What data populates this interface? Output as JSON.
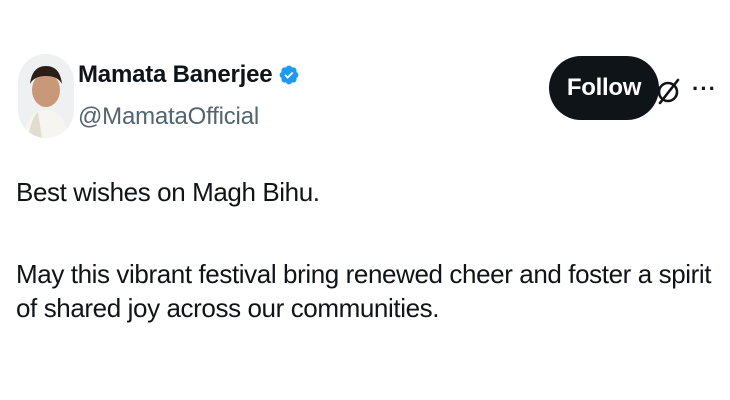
{
  "author": {
    "display_name": "Mamata Banerjee",
    "handle": "@MamataOfficial",
    "verified_icon": "verified-badge-icon",
    "avatar_icon": "profile-avatar"
  },
  "actions": {
    "follow_label": "Follow",
    "grok_icon": "grok-icon",
    "more_icon": "more-options-icon",
    "more_glyph": "···"
  },
  "tweet": {
    "paragraph_1": "Best wishes on Magh Bihu.",
    "paragraph_2": "May this vibrant festival bring renewed cheer and foster a spirit of shared joy across our communities."
  },
  "colors": {
    "follow_bg": "#0f1419",
    "verified": "#1d9bf0",
    "handle": "#536471"
  }
}
